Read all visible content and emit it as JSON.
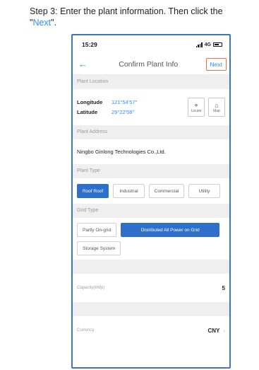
{
  "instruction": {
    "line1": "Step 3: Enter the plant information. Then click the",
    "quote_open": "\"",
    "next_word": "Next",
    "quote_close": "\"."
  },
  "status_bar": {
    "time": "15:29",
    "network": "4G"
  },
  "nav": {
    "back_icon": "arrow-left-icon",
    "title": "Confirm Plant Info",
    "next_label": "Next"
  },
  "plant_location": {
    "header": "Plant Location",
    "longitude_label": "Longitude",
    "longitude_value": "121°54'57\"",
    "latitude_label": "Latitude",
    "latitude_value": "29°22'58\"",
    "locate_label": "Locate",
    "map_label": "Map"
  },
  "plant_address": {
    "header": "Plant Address",
    "value": "Ningbo Ginlong Technologies Co.,Ltd."
  },
  "plant_type": {
    "header": "Plant Type",
    "options": [
      "Roof Roof",
      "Industrial",
      "Commercial",
      "Utility"
    ],
    "selected": "Roof Roof"
  },
  "grid_type": {
    "header": "Grid Type",
    "options": [
      "Partly On-grid",
      "Distributed All Power on Grid",
      "Storage System"
    ],
    "selected": "Distributed All Power on Grid"
  },
  "capacity": {
    "label": "Capacity(kWp)",
    "value": "5"
  },
  "currency": {
    "label": "Currency",
    "value": "CNY"
  },
  "colors": {
    "accent": "#2f8df0",
    "selected_chip": "#2e6fc9",
    "next_border": "#e8704b",
    "phone_frame": "#3d74c9"
  }
}
